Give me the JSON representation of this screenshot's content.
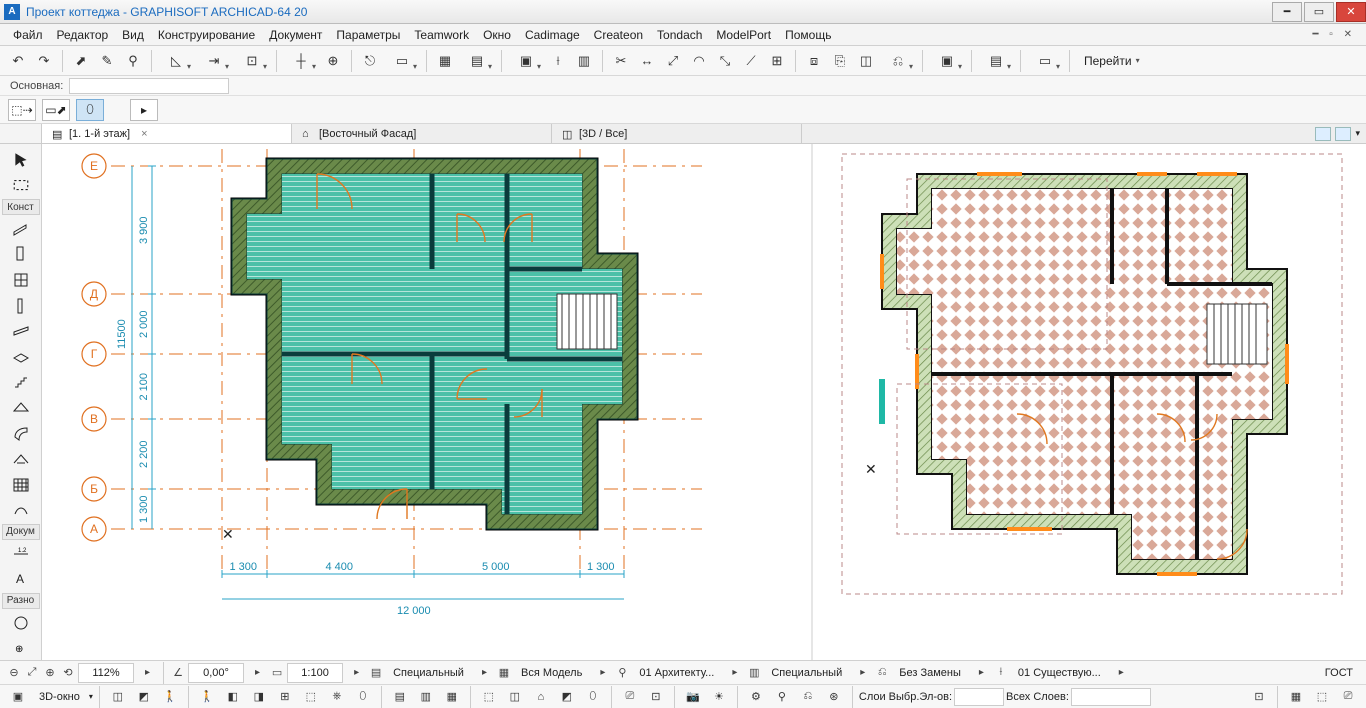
{
  "title": "Проект коттеджа - GRAPHISOFT ARCHICAD-64 20",
  "app_icon_letter": "A",
  "menu": [
    "Файл",
    "Редактор",
    "Вид",
    "Конструирование",
    "Документ",
    "Параметры",
    "Teamwork",
    "Окно",
    "Cadimage",
    "Createon",
    "Tondach",
    "ModelPort",
    "Помощь"
  ],
  "goto_label": "Перейти",
  "layer_label": "Основная:",
  "tabs": {
    "t1": "[1. 1-й этаж]",
    "t2": "[Восточный Фасад]",
    "t3": "[3D / Все]"
  },
  "toolbox": {
    "hdr1": "Конст",
    "hdr2": "Докум",
    "hdr3": "Разно"
  },
  "axes": {
    "rows": [
      "Е",
      "Д",
      "Г",
      "В",
      "Б",
      "А"
    ],
    "row_y": [
      22,
      150,
      210,
      275,
      345,
      385
    ],
    "hdim_labels": [
      "1 300",
      "4 400",
      "5 000",
      "1 300"
    ],
    "hdim_total": "12 000",
    "vdim_labels": [
      "3 900",
      "2 000",
      "2 100",
      "2 200",
      "1 300"
    ],
    "vdim_total": "11500"
  },
  "status": {
    "zoom": "112%",
    "angle": "0,00°",
    "scale": "1:100",
    "s1": "Специальный",
    "s2": "Вся Модель",
    "s3": "01 Архитекту...",
    "s4": "Специальный",
    "s5": "Без Замены",
    "s6": "01 Существую...",
    "s7": "ГОСТ"
  },
  "bottom": {
    "view3d": "3D-окно",
    "sel_layers": "Слои Выбр.Эл-ов:",
    "all_layers": "Всех Слоев:"
  }
}
